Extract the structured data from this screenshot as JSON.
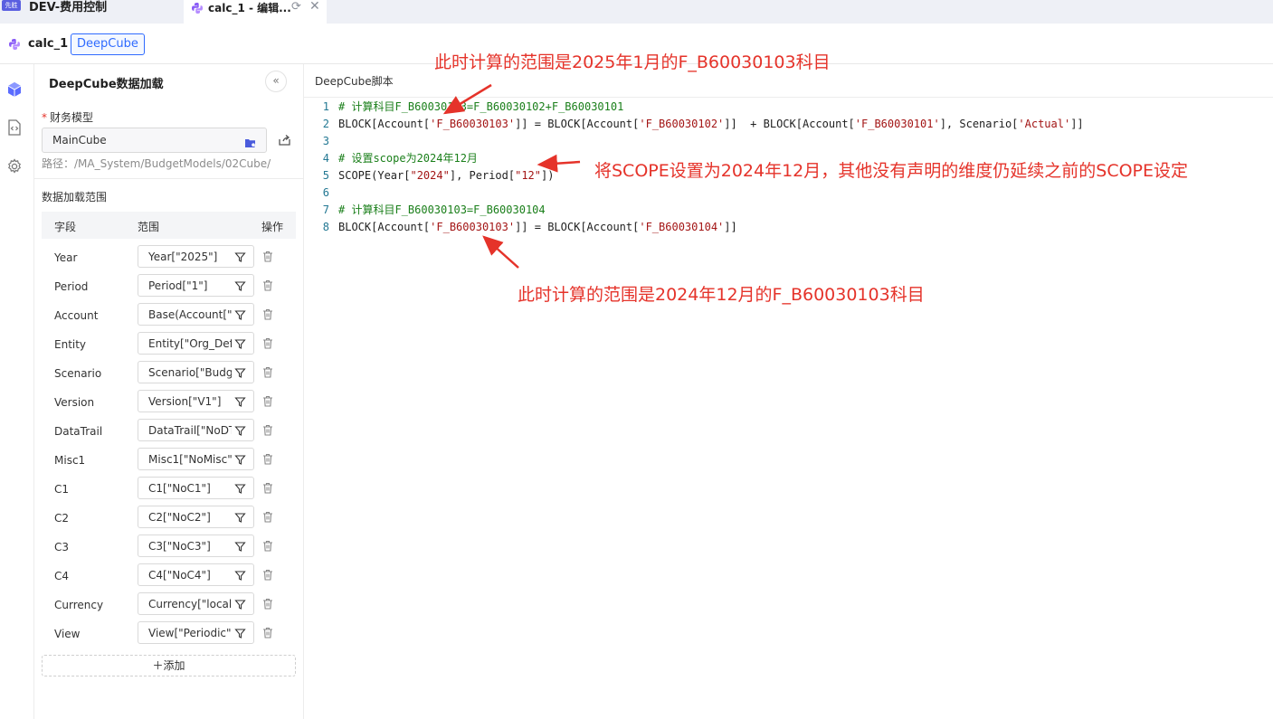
{
  "topbar": {
    "app_badge": "先胜",
    "app_title": "DEV-费用控制",
    "active_tab": {
      "label": "calc_1 - 编辑...",
      "refresh_icon": "refresh-icon",
      "close_icon": "close-icon"
    }
  },
  "header": {
    "doc_name": "calc_1",
    "doc_tag": "DeepCube"
  },
  "rail": {
    "icons": [
      "cube-icon",
      "code-file-icon",
      "settings-icon"
    ]
  },
  "panel": {
    "title": "DeepCube数据加载",
    "model_label": "财务模型",
    "model_value": "MainCube",
    "path": "路径：/MA_System/BudgetModels/02Cube/",
    "range_title": "数据加载范围",
    "columns": {
      "field": "字段",
      "range": "范围",
      "action": "操作"
    },
    "rows": [
      {
        "field": "Year",
        "range": "Year[\"2025\"]"
      },
      {
        "field": "Period",
        "range": "Period[\"1\"]"
      },
      {
        "field": "Account",
        "range": "Base(Account[\"F_B"
      },
      {
        "field": "Entity",
        "range": "Entity[\"Org_Def_"
      },
      {
        "field": "Scenario",
        "range": "Scenario[\"Budge"
      },
      {
        "field": "Version",
        "range": "Version[\"V1\"]"
      },
      {
        "field": "DataTrail",
        "range": "DataTrail[\"NoDTr"
      },
      {
        "field": "Misc1",
        "range": "Misc1[\"NoMisc\"]"
      },
      {
        "field": "C1",
        "range": "C1[\"NoC1\"]"
      },
      {
        "field": "C2",
        "range": "C2[\"NoC2\"]"
      },
      {
        "field": "C3",
        "range": "C3[\"NoC3\"]"
      },
      {
        "field": "C4",
        "range": "C4[\"NoC4\"]"
      },
      {
        "field": "Currency",
        "range": "Currency[\"local\"]"
      },
      {
        "field": "View",
        "range": "View[\"Periodic\"]"
      }
    ],
    "add_label": "＋添加"
  },
  "editor": {
    "title": "DeepCube脚本",
    "lines": [
      {
        "num": "1",
        "text": "# 计算科目F_B60030103=F_B60030102+F_B60030101"
      },
      {
        "num": "2",
        "text": "BLOCK[Account['F_B60030103']] = BLOCK[Account['F_B60030102']]  + BLOCK[Account['F_B60030101'], Scenario['Actual']]"
      },
      {
        "num": "3",
        "text": ""
      },
      {
        "num": "4",
        "text": "# 设置scope为2024年12月"
      },
      {
        "num": "5",
        "text": "SCOPE(Year[\"2024\"], Period[\"12\"])"
      },
      {
        "num": "6",
        "text": ""
      },
      {
        "num": "7",
        "text": "# 计算科目F_B60030103=F_B60030104"
      },
      {
        "num": "8",
        "text": "BLOCK[Account['F_B60030103']] = BLOCK[Account['F_B60030104']]"
      }
    ]
  },
  "annotations": {
    "top": "此时计算的范围是2025年1月的F_B60030103科目",
    "middle": "将SCOPE设置为2024年12月，其他没有声明的维度仍延续之前的SCOPE设定",
    "bottom": "此时计算的范围是2024年12月的F_B60030103科目",
    "color": "#e5332a"
  },
  "colors": {
    "accent": "#2f6bff",
    "comment": "#1a7f1a",
    "string": "#a31515",
    "line_number": "#237893"
  }
}
